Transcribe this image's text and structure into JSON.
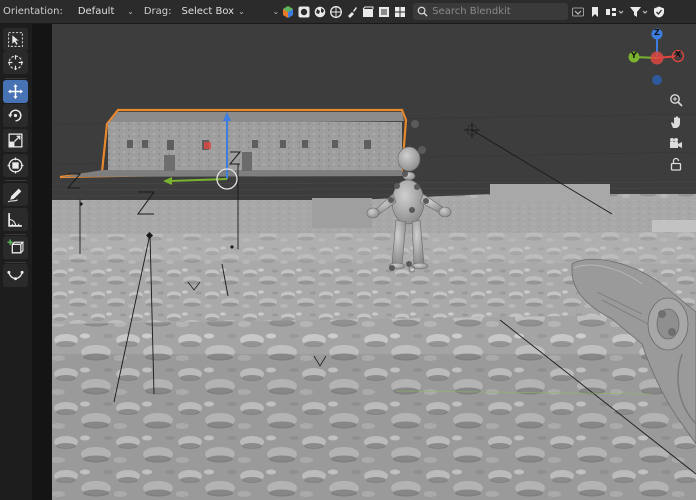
{
  "header": {
    "orientation_label": "Orientation:",
    "orientation_value": "Default",
    "drag_label": "Drag:",
    "drag_value": "Select Box",
    "search_placeholder": "Search Blendkit"
  },
  "toolbar": {
    "tools": [
      {
        "name": "select-box-tool",
        "icon": "cursor-icon"
      },
      {
        "name": "cursor-tool",
        "icon": "crosshair-icon"
      },
      {
        "name": "move-tool",
        "icon": "move-arrows-icon",
        "active": true
      },
      {
        "name": "rotate-tool",
        "icon": "rotate-icon"
      },
      {
        "name": "scale-tool",
        "icon": "scale-icon"
      },
      {
        "name": "transform-tool",
        "icon": "transform-icon"
      },
      {
        "name": "annotate-tool",
        "icon": "pencil-icon"
      },
      {
        "name": "measure-tool",
        "icon": "ruler-icon"
      },
      {
        "name": "add-cube-tool",
        "icon": "add-cube-icon"
      },
      {
        "name": "curve-tool",
        "icon": "curve-icon"
      }
    ]
  },
  "gizmo": {
    "x_label": "X",
    "y_label": "Y",
    "z_label": "Z"
  },
  "colors": {
    "active_tool": "#4772b3",
    "selection_outline": "#e8892d",
    "axis_x": "#e0463f",
    "axis_y": "#7ab32d",
    "axis_z": "#3d7de0"
  }
}
